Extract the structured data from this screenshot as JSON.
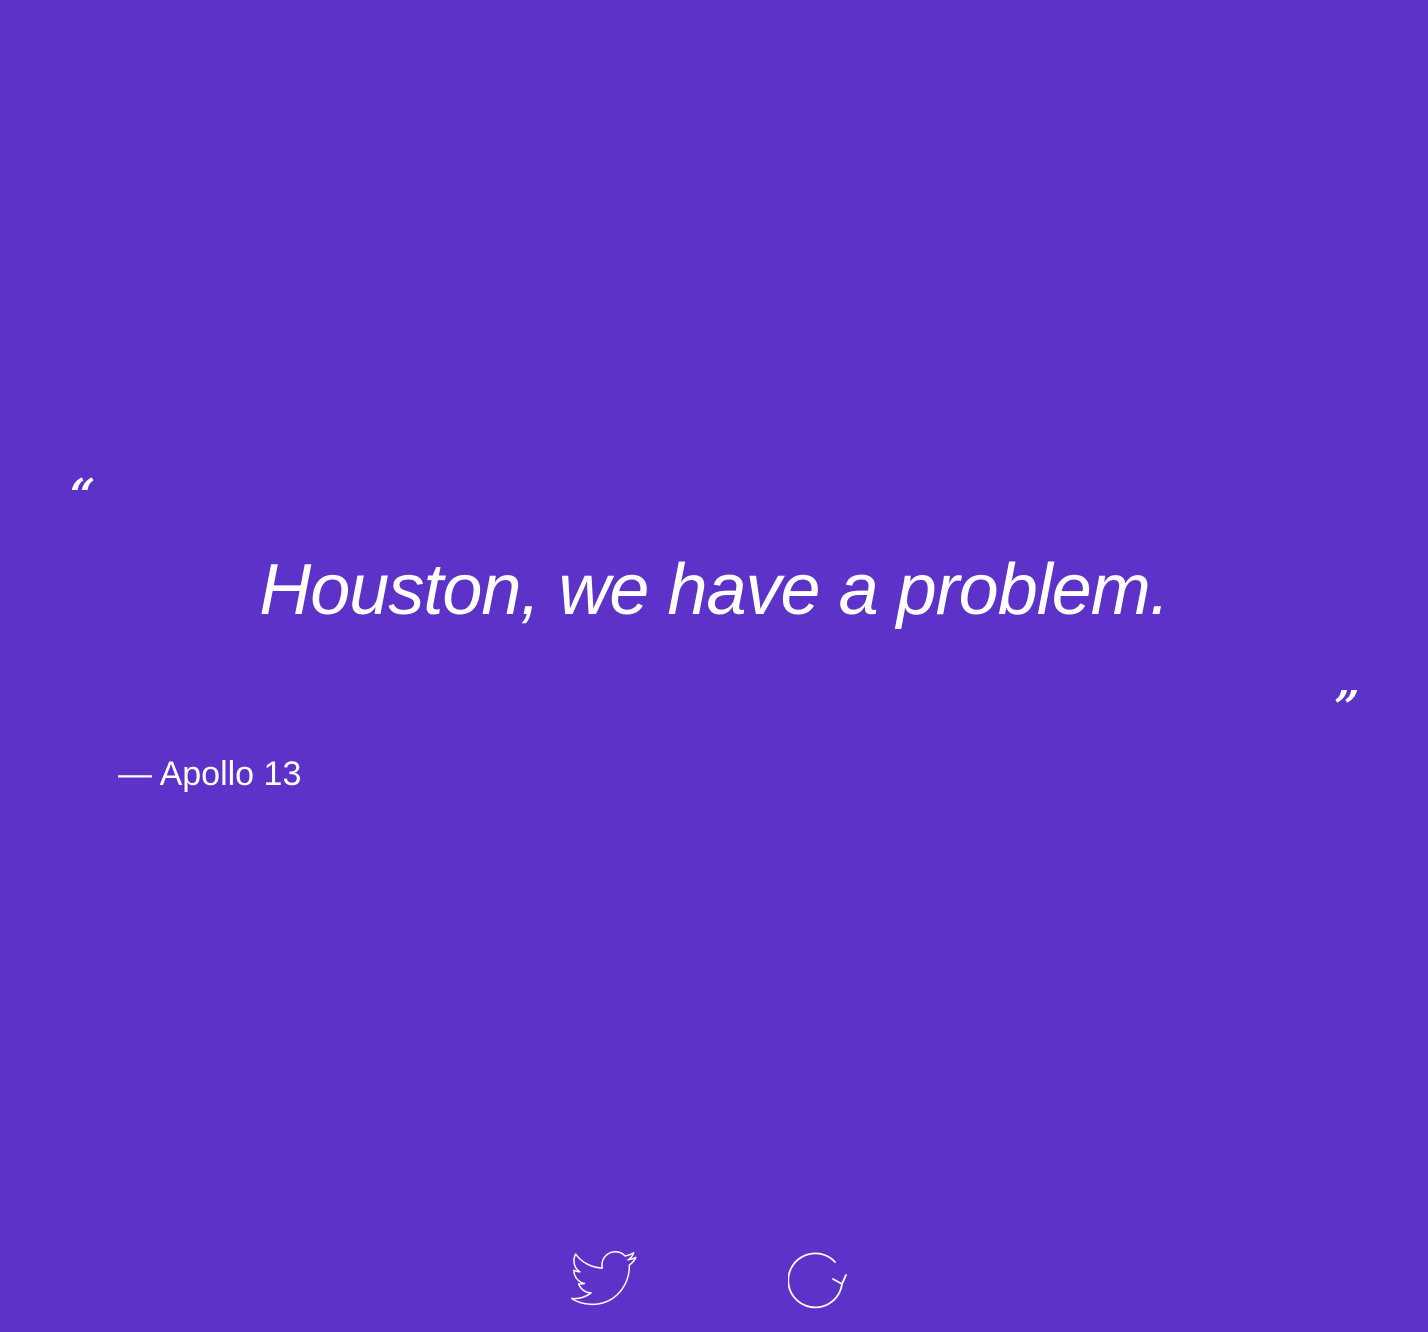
{
  "theme": {
    "background": "#5c32c8",
    "foreground": "#ffffff"
  },
  "quote": {
    "open_mark": "“",
    "text": "Houston, we have a problem.",
    "close_mark": "”",
    "author": "— Apollo 13"
  },
  "actions": {
    "tweet_icon": "twitter-bird-icon",
    "new_quote_icon": "refresh-icon"
  }
}
